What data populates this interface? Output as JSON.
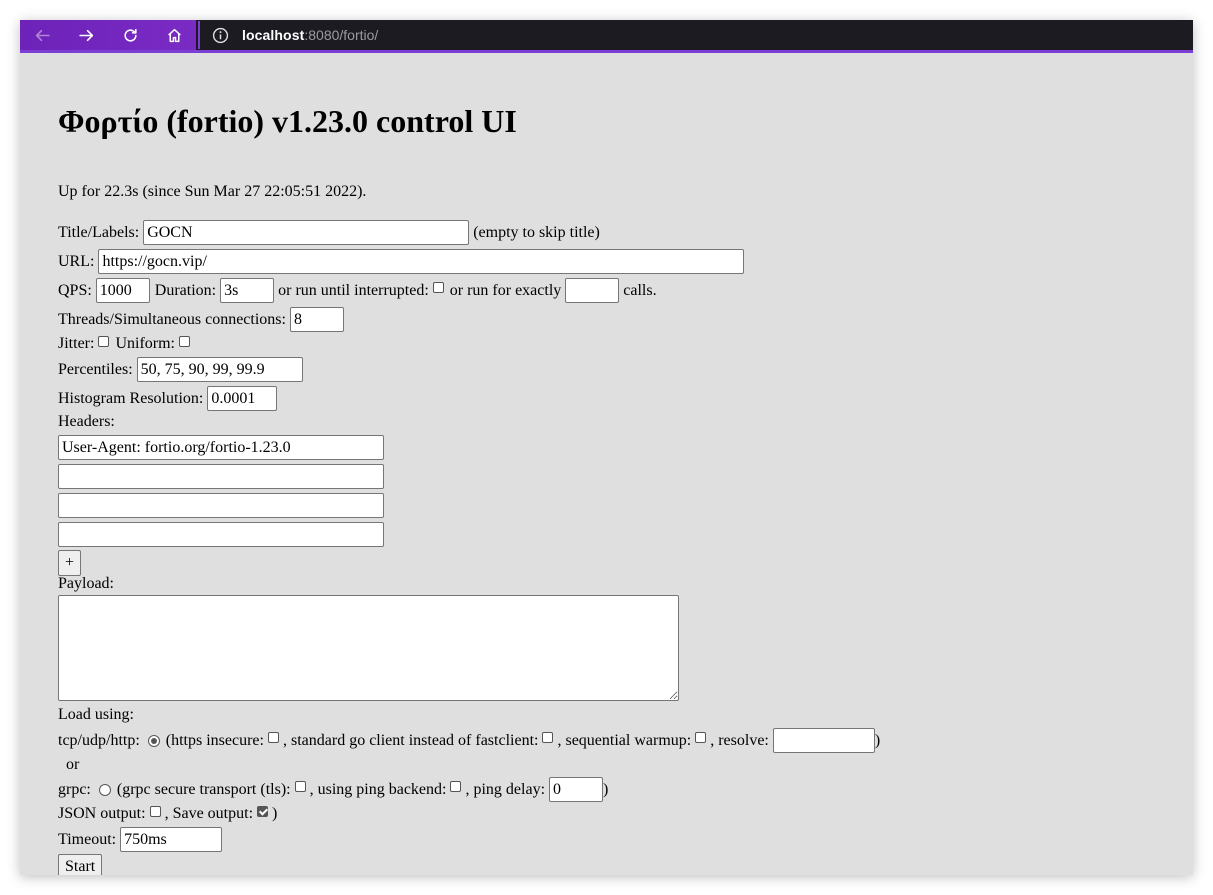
{
  "browser": {
    "url_host": "localhost",
    "url_rest": ":8080/fortio/",
    "accent_color": "#7b3fd6",
    "nav_icons": [
      "back-arrow-icon",
      "forward-arrow-icon",
      "reload-icon",
      "home-icon",
      "info-icon"
    ]
  },
  "page": {
    "title": "Φορτίο (fortio) v1.23.0 control UI",
    "uptime": "Up for 22.3s (since Sun Mar 27 22:05:51 2022)."
  },
  "form": {
    "title_label": "Title/Labels:",
    "title_value": "GOCN",
    "title_hint": "(empty to skip title)",
    "url_label": "URL:",
    "url_value": "https://gocn.vip/",
    "qps_label": "QPS:",
    "qps_value": "1000",
    "duration_label": "Duration:",
    "duration_value": "3s",
    "run_until_label": "or run until interrupted:",
    "run_exactly_label": "or run for exactly",
    "calls_value": "",
    "calls_label": "calls.",
    "threads_label": "Threads/Simultaneous connections:",
    "threads_value": "8",
    "jitter_label": "Jitter:",
    "uniform_label": "Uniform:",
    "percentiles_label": "Percentiles:",
    "percentiles_value": "50, 75, 90, 99, 99.9",
    "histogram_label": "Histogram Resolution:",
    "histogram_value": "0.0001",
    "headers_label": "Headers:",
    "headers": [
      "User-Agent: fortio.org/fortio-1.23.0",
      "",
      "",
      ""
    ],
    "add_header_label": "+",
    "payload_label": "Payload:",
    "payload_value": "",
    "load_using_label": "Load using:",
    "http_label": "tcp/udp/http:",
    "https_insecure_label": "(https insecure:",
    "std_client_label": ", standard go client instead of fastclient:",
    "seq_warmup_label": ", sequential warmup:",
    "resolve_label": ", resolve:",
    "resolve_value": "",
    "close_paren": ")",
    "or_label": "or",
    "grpc_label": "grpc:",
    "grpc_tls_label": "(grpc secure transport (tls):",
    "ping_backend_label": ", using ping backend:",
    "ping_delay_label": ", ping delay:",
    "ping_delay_value": "0",
    "json_output_label": "JSON output:",
    "save_output_label": ", Save output:",
    "timeout_label": "Timeout:",
    "timeout_value": "750ms",
    "start_label": "Start"
  }
}
